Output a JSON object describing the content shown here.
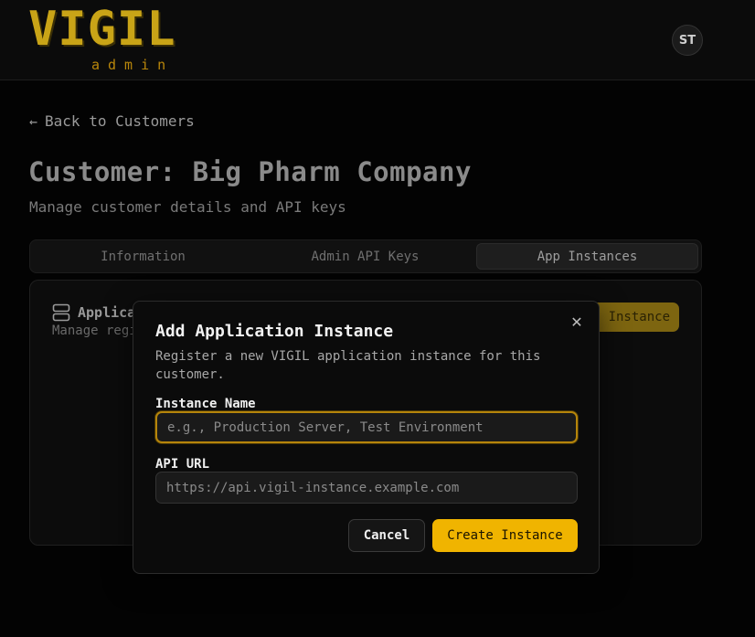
{
  "header": {
    "logo_word": "VIGIL",
    "logo_sub": "admin",
    "avatar_initials": "ST"
  },
  "content": {
    "back_link": "Back to Customers",
    "page_title": "Customer: Big Pharm Company",
    "page_subtitle": "Manage customer details and API keys",
    "tabs": [
      {
        "label": "Information",
        "active": false
      },
      {
        "label": "Admin API Keys",
        "active": false
      },
      {
        "label": "App Instances",
        "active": true
      }
    ],
    "card": {
      "title": "Applica",
      "description": "Manage regi",
      "add_button": "Instance",
      "icon": "server-icon"
    }
  },
  "modal": {
    "title": "Add Application Instance",
    "description": "Register a new VIGIL application instance for this customer.",
    "instance_name_label": "Instance Name",
    "instance_name_placeholder": "e.g., Production Server, Test Environment",
    "api_url_label": "API URL",
    "api_url_placeholder": "https://api.vigil-instance.example.com",
    "cancel_label": "Cancel",
    "create_label": "Create Instance",
    "close_icon": "close-icon"
  },
  "colors": {
    "accent": "#f0b400",
    "background": "#030303",
    "focus_border": "#b5850b"
  }
}
